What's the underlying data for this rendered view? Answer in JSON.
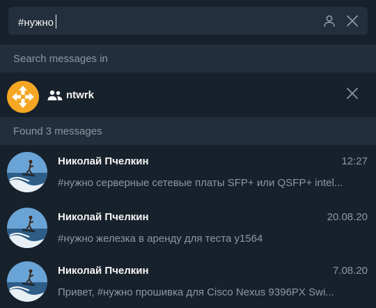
{
  "search": {
    "query": "#нужно",
    "user_icon": "person-icon",
    "clear_icon": "close-icon"
  },
  "search_in": {
    "header": "Search messages in",
    "chat_name": "ntwrk",
    "chat_icon": "group-icon",
    "avatar_icon": "arrows-logo-icon",
    "remove_icon": "close-icon"
  },
  "results": {
    "header": "Found 3 messages",
    "messages": [
      {
        "sender": "Николай Пчелкин",
        "date": "12:27",
        "text": "#нужно серверные сетевые платы SFP+ или QSFP+ intel..."
      },
      {
        "sender": "Николай Пчелкин",
        "date": "20.08.20",
        "text": "#нужно железка в аренду для теста у1564"
      },
      {
        "sender": "Николай Пчелкин",
        "date": "7.08.20",
        "text": "Привет, #нужно  прошивка для Cisco Nexus 9396PX Swi..."
      }
    ]
  },
  "colors": {
    "background": "#17212b",
    "field": "#242f3d",
    "section": "#232e3c",
    "muted_text": "#8d98a4",
    "accent_orange": "#f5a623"
  }
}
